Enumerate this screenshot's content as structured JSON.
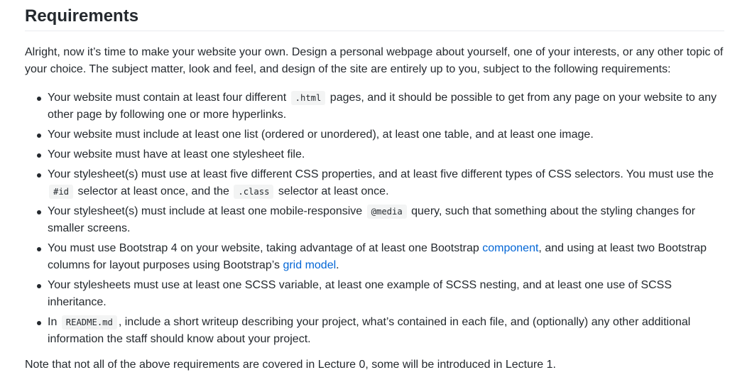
{
  "heading": "Requirements",
  "intro": "Alright, now it’s time to make your website your own. Design a personal webpage about yourself, one of your interests, or any other topic of your choice. The subject matter, look and feel, and design of the site are entirely up to you, subject to the following requirements:",
  "requirements": [
    {
      "before": "Your website must contain at least four different",
      "code": ".html",
      "after": "pages, and it should be possible to get from any page on your website to any other page by following one or more hyperlinks."
    },
    {
      "text": "Your website must include at least one list (ordered or unordered), at least one table, and at least one image."
    },
    {
      "text": "Your website must have at least one stylesheet file."
    },
    {
      "before": "Your stylesheet(s) must use at least five different CSS properties, and at least five different types of CSS selectors. You must use the",
      "code1": "#id",
      "middle": "selector at least once, and the",
      "code2": ".class",
      "after": "selector at least once."
    },
    {
      "before": "Your stylesheet(s) must include at least one mobile-responsive",
      "code": "@media",
      "after": "query, such that something about the styling changes for smaller screens."
    },
    {
      "before": "You must use Bootstrap 4 on your website, taking advantage of at least one Bootstrap",
      "link1": "component",
      "middle": ", and using at least two Bootstrap columns for layout purposes using Bootstrap’s",
      "link2": "grid model",
      "after": "."
    },
    {
      "text": "Your stylesheets must use at least one SCSS variable, at least one example of SCSS nesting, and at least one use of SCSS inheritance."
    },
    {
      "before": "In",
      "code": "README.md",
      "after": ", include a short writeup describing your project, what’s contained in each file, and (optionally) any other additional information the staff should know about your project."
    }
  ],
  "note": "Note that not all of the above requirements are covered in Lecture 0, some will be introduced in Lecture 1.",
  "colors": {
    "text": "#24292e",
    "link": "#0366d6",
    "code_bg": "#f3f4f4",
    "rule": "#eaecef"
  }
}
